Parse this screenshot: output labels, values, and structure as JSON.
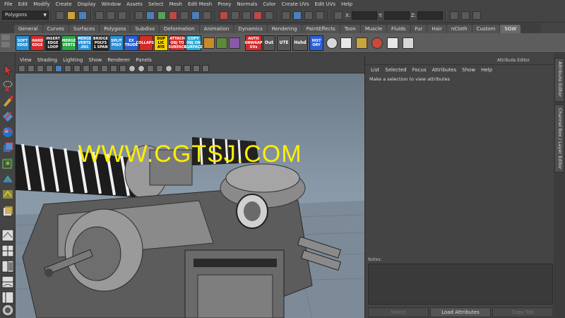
{
  "menubar": [
    "File",
    "Edit",
    "Modify",
    "Create",
    "Display",
    "Window",
    "Assets",
    "Select",
    "Mesh",
    "Edit Mesh",
    "Proxy",
    "Normals",
    "Color",
    "Create UVs",
    "Edit UVs",
    "Help"
  ],
  "statusline": {
    "mode": "Polygons",
    "x_label": "X:",
    "y_label": "Y:",
    "z_label": "Z:"
  },
  "shelf_tabs": [
    "General",
    "Curves",
    "Surfaces",
    "Polygons",
    "Subdivs",
    "Deformation",
    "Animation",
    "Dynamics",
    "Rendering",
    "PaintEffects",
    "Toon",
    "Muscle",
    "Fluids",
    "Fur",
    "Hair",
    "nCloth",
    "Custom",
    "SGW"
  ],
  "active_shelf_tab": "SGW",
  "shelf_buttons": [
    {
      "label": "SOFT EDGE",
      "color": "#2a8fd4"
    },
    {
      "label": "HARD EDGE",
      "color": "#d42a2a"
    },
    {
      "label": "INSERT EDGE LOOP",
      "color": "#222222"
    },
    {
      "label": "MERGE VERTS",
      "color": "#2aa848"
    },
    {
      "label": "MERGE VERTS .001",
      "color": "#2a8fd4"
    },
    {
      "label": "BRIDGE POLYS 1 SPAN",
      "color": "#222222"
    },
    {
      "label": "SPLIT POLY",
      "color": "#2a8fd4"
    },
    {
      "label": "EX TRUDE",
      "color": "#2a5fd4"
    },
    {
      "label": "COLLAPSE",
      "color": "#d42a2a"
    },
    {
      "label": "DUP LIC ATE",
      "color": "#f0d000"
    },
    {
      "label": "ATTACH OBJ TO SURFACE",
      "color": "#d42a2a"
    },
    {
      "label": "COPY OBJ ON SURFACE",
      "color": "#2aa8d4"
    },
    {
      "label": "AUTO UNWRAP UVs",
      "color": "#d42a2a"
    },
    {
      "label": "Out",
      "color": "#555555"
    },
    {
      "label": "UTE",
      "color": "#555555"
    },
    {
      "label": "Hshd",
      "color": "#555555"
    },
    {
      "label": "HIST ORY",
      "color": "#2a5fd4"
    }
  ],
  "viewport": {
    "menu": [
      "View",
      "Shading",
      "Lighting",
      "Show",
      "Renderer",
      "Panels"
    ],
    "watermark": "WWW.CGTSJ.COM"
  },
  "attribute_editor": {
    "title": "Attribute Editor",
    "menu": [
      "List",
      "Selected",
      "Focus",
      "Attributes",
      "Show",
      "Help"
    ],
    "message": "Make a selection to view attributes",
    "notes_label": "Notes:",
    "buttons": [
      "Select",
      "Load Attributes",
      "Copy Tab"
    ]
  },
  "side_tabs": [
    "Attribute Editor",
    "Channel Box / Layer Editor"
  ]
}
